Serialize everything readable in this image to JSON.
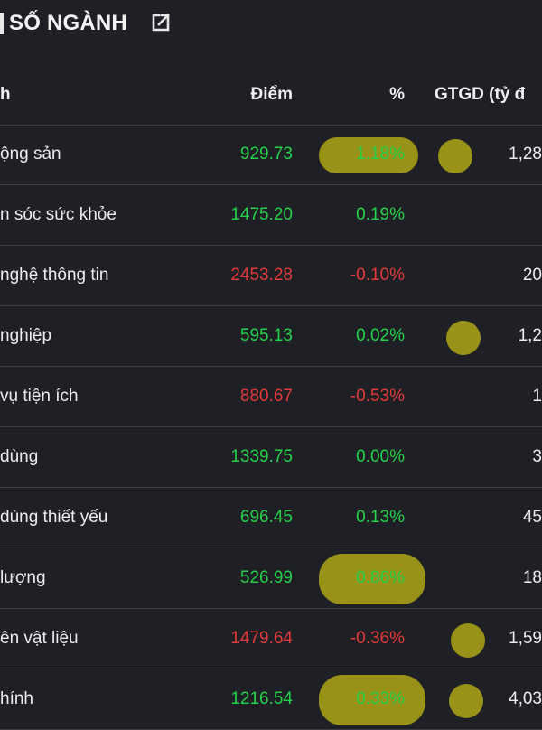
{
  "title": {
    "text": "SỐ NGÀNH"
  },
  "table": {
    "headers": {
      "name": "h",
      "diem": "Điểm",
      "pct": "%",
      "gtgd": "GTGD (tỷ đ"
    },
    "rows": [
      {
        "name": "ộng sản",
        "diem": "929.73",
        "pct": "1.18%",
        "gtgd": "1,28",
        "trend": "up"
      },
      {
        "name": "n sóc sức khỏe",
        "diem": "1475.20",
        "pct": "0.19%",
        "gtgd": "",
        "trend": "up"
      },
      {
        "name": " nghệ thông tin",
        "diem": "2453.28",
        "pct": "-0.10%",
        "gtgd": "20",
        "trend": "down"
      },
      {
        "name": " nghiệp",
        "diem": "595.13",
        "pct": "0.02%",
        "gtgd": "1,2",
        "trend": "up"
      },
      {
        "name": "vụ tiện ích",
        "diem": "880.67",
        "pct": "-0.53%",
        "gtgd": "1",
        "trend": "down"
      },
      {
        "name": " dùng",
        "diem": "1339.75",
        "pct": "0.00%",
        "gtgd": "3",
        "trend": "flat"
      },
      {
        "name": " dùng thiết yếu",
        "diem": "696.45",
        "pct": "0.13%",
        "gtgd": "45",
        "trend": "up"
      },
      {
        "name": " lượng",
        "diem": "526.99",
        "pct": "0.86%",
        "gtgd": "18",
        "trend": "up"
      },
      {
        "name": "ên vật liệu",
        "diem": "1479.64",
        "pct": "-0.36%",
        "gtgd": "1,59",
        "trend": "down"
      },
      {
        "name": "hính",
        "diem": "1216.54",
        "pct": "0.33%",
        "gtgd": "4,03",
        "trend": "up"
      }
    ]
  },
  "colors": {
    "up": "#25d04a",
    "down": "#e03a3a",
    "highlight": "#c8be14",
    "background": "#1f2025"
  },
  "icons": {
    "title_link": "external-link-icon"
  }
}
